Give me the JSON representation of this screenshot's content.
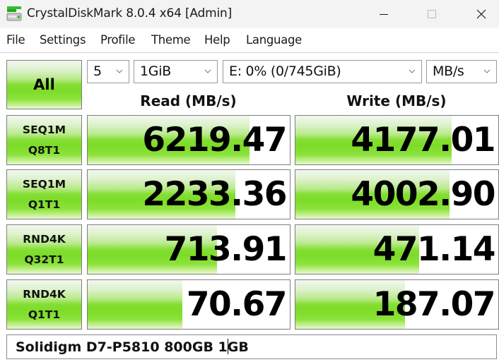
{
  "window": {
    "title": "CrystalDiskMark 8.0.4 x64 [Admin]",
    "app_icon": "disk-drive-icon",
    "controls": [
      "minimize",
      "maximize",
      "close"
    ]
  },
  "menu": {
    "items": [
      "File",
      "Settings",
      "Profile",
      "Theme",
      "Help",
      "Language"
    ]
  },
  "toolbar": {
    "all_label": "All",
    "count": "5",
    "size": "1GiB",
    "drive": "E: 0% (0/745GiB)",
    "unit": "MB/s"
  },
  "headers": {
    "read": "Read (MB/s)",
    "write": "Write (MB/s)"
  },
  "rows": [
    {
      "line1": "SEQ1M",
      "line2": "Q8T1",
      "read": "6219.47",
      "write": "4177.01",
      "read_fill": 0.8,
      "write_fill": 0.77
    },
    {
      "line1": "SEQ1M",
      "line2": "Q1T1",
      "read": "2233.36",
      "write": "4002.90",
      "read_fill": 0.73,
      "write_fill": 0.76
    },
    {
      "line1": "RND4K",
      "line2": "Q32T1",
      "read": "713.91",
      "write": "471.14",
      "read_fill": 0.64,
      "write_fill": 0.61
    },
    {
      "line1": "RND4K",
      "line2": "Q1T1",
      "read": "70.67",
      "write": "187.07",
      "read_fill": 0.47,
      "write_fill": 0.54
    }
  ],
  "comment": {
    "before_caret": "Solidigm D7-P5810 800GB 1",
    "after_caret": "GB"
  },
  "colors": {
    "bar_green": "#7ddc28",
    "border": "#7e7e7e",
    "titlebar_bg": "#f3f3f3"
  }
}
